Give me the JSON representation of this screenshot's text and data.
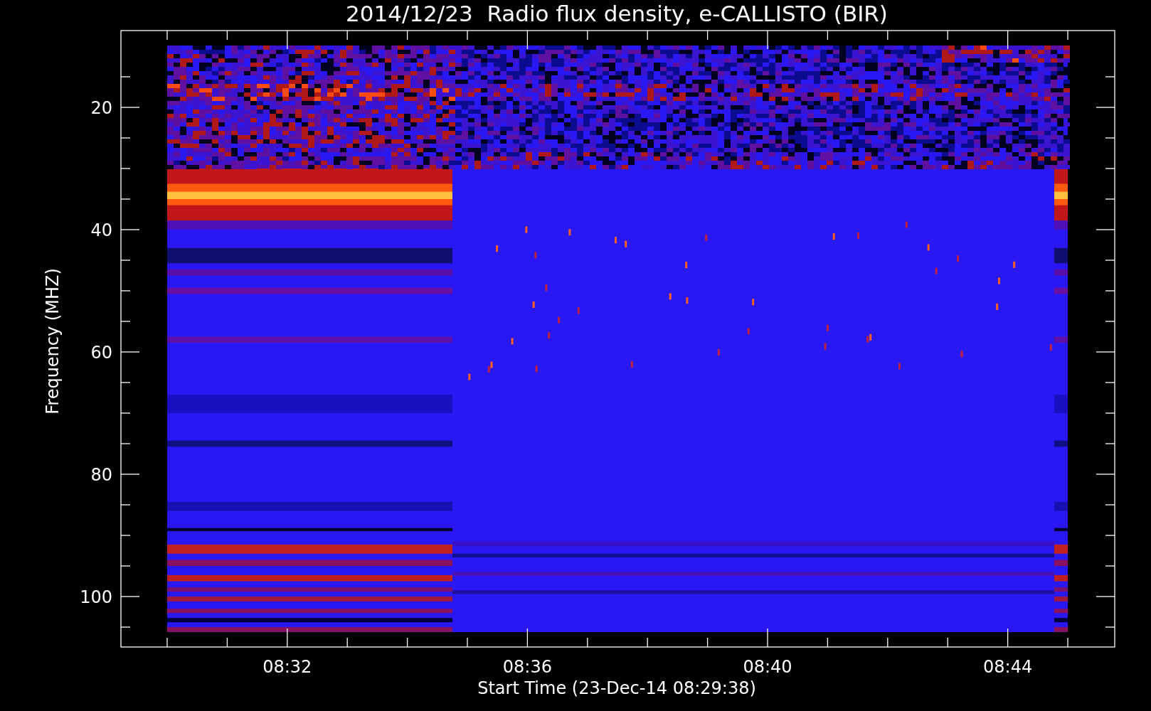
{
  "plot": {
    "title": "2014/12/23  Radio flux density, e-CALLISTO (BIR)",
    "xlabel": "Start Time (23-Dec-14 08:29:38)",
    "ylabel": "Frequency (MHZ)",
    "yticks": [
      "20",
      "40",
      "60",
      "80",
      "100"
    ],
    "xticks": [
      "08:32",
      "08:36",
      "08:40",
      "08:44"
    ]
  }
}
